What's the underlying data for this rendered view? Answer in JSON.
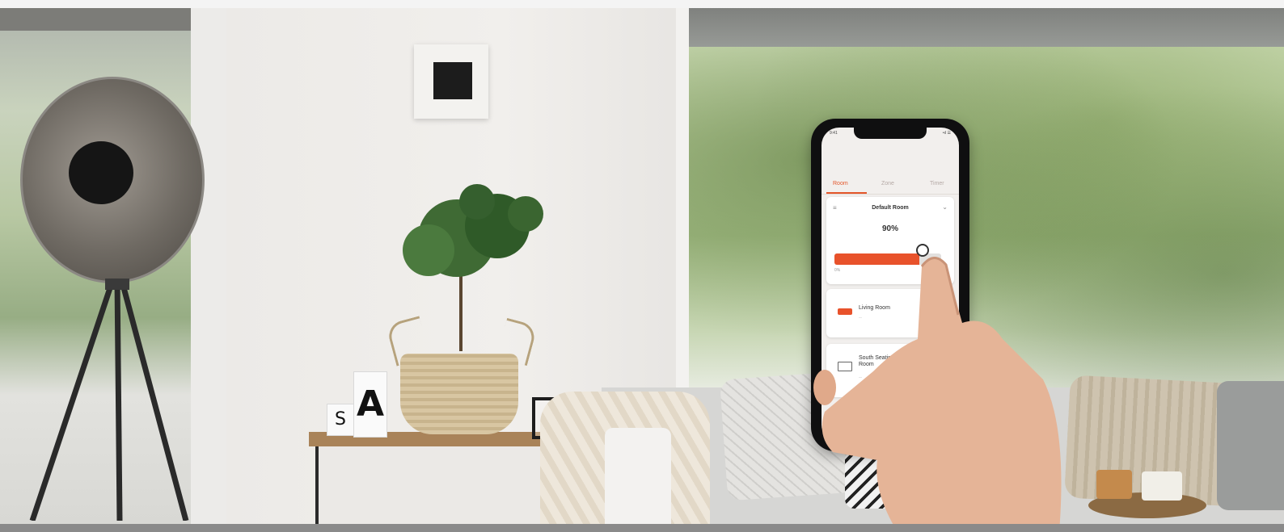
{
  "scene": {
    "description_tags": [
      "lamp-icon",
      "plant",
      "smartphone",
      "hand"
    ]
  },
  "phone": {
    "status_time": "9:41",
    "status_signal": "•ıl ☰",
    "tabs": [
      {
        "label": "Room",
        "active": true
      },
      {
        "label": "Zone",
        "active": false
      },
      {
        "label": "Timer",
        "active": false
      }
    ],
    "default_room": {
      "title": "Default Room",
      "percent": "90%",
      "level": 0.9,
      "min_label": "0%"
    },
    "rooms": [
      {
        "label": "Living Room",
        "sub": "—"
      },
      {
        "label": "South Seating\nRoom",
        "sub": "—"
      }
    ]
  },
  "decor": {
    "candle_s_letter": "S",
    "candle_a_letter": "A"
  },
  "colors": {
    "accent": "#e8522b",
    "wall": "#eceae7",
    "wood": "#a98359"
  }
}
